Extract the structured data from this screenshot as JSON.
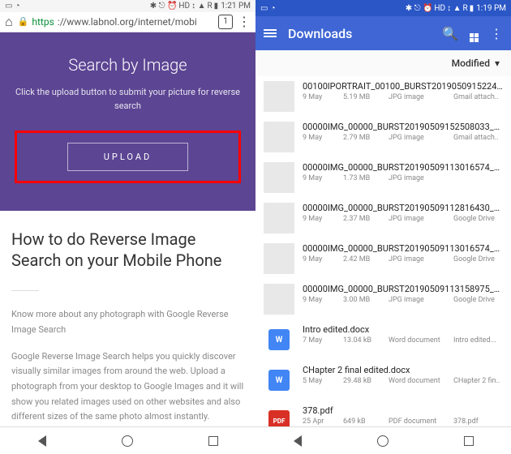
{
  "left": {
    "status": {
      "time": "1:21 PM",
      "hd": "HD",
      "net": "R"
    },
    "addr": {
      "proto": "https",
      "host": "://www.labnol.org",
      "path": "/internet/mobi",
      "tabs": "1"
    },
    "hero": {
      "title": "Search by Image",
      "subtitle": "Click the upload button to submit your picture for reverse search",
      "button": "UPLOAD"
    },
    "article": {
      "title": "How to do Reverse Image Search on your Mobile Phone",
      "p1": "Know more about any photograph with Google Reverse Image Search",
      "p2": "Google Reverse Image Search helps you quickly discover visually similar images from around the web. Upload a photograph from your desktop to Google Images and it will show you related images used on other websites and also different sizes of the same photo almost instantly."
    }
  },
  "right": {
    "status": {
      "time": "1:19 PM",
      "hd": "HD",
      "net": "R"
    },
    "app": {
      "title": "Downloads"
    },
    "sort": "Modified",
    "files": [
      {
        "name": "00100lPORTRAIT_00100_BURST20190509152241..",
        "date": "9 May",
        "size": "5.19 MB",
        "type": "JPG image",
        "src": "Gmail attach..",
        "thumb": "img"
      },
      {
        "name": "00000IMG_00000_BURST20190509152508033_C...",
        "date": "9 May",
        "size": "2.79 MB",
        "type": "JPG image",
        "src": "Gmail attach..",
        "thumb": "img"
      },
      {
        "name": "00000IMG_00000_BURST20190509113016574_C...",
        "date": "9 May",
        "size": "1.73 MB",
        "type": "JPG image",
        "src": "",
        "thumb": "img"
      },
      {
        "name": "00000IMG_00000_BURST20190509112816430_C...",
        "date": "9 May",
        "size": "2.37 MB",
        "type": "JPG image",
        "src": "Google Drive",
        "thumb": "img"
      },
      {
        "name": "00000IMG_00000_BURST20190509113016574_C...",
        "date": "9 May",
        "size": "2.42 MB",
        "type": "JPG image",
        "src": "Google Drive",
        "thumb": "img"
      },
      {
        "name": "00000IMG_00000_BURST20190509113158975_C...",
        "date": "9 May",
        "size": "3.00 MB",
        "type": "JPG image",
        "src": "Google Drive",
        "thumb": "img"
      },
      {
        "name": "Intro edited.docx",
        "date": "7 May",
        "size": "13.04 kB",
        "type": "Word document",
        "src": "Intro edited...",
        "thumb": "doc"
      },
      {
        "name": "CHapter 2 final edited.docx",
        "date": "5 May",
        "size": "29.48 kB",
        "type": "Word document",
        "src": "CHapter 2 fin..",
        "thumb": "doc"
      },
      {
        "name": "378.pdf",
        "date": "25 Apr",
        "size": "649 kB",
        "type": "PDF document",
        "src": "378.pdf",
        "thumb": "pdf"
      }
    ]
  }
}
